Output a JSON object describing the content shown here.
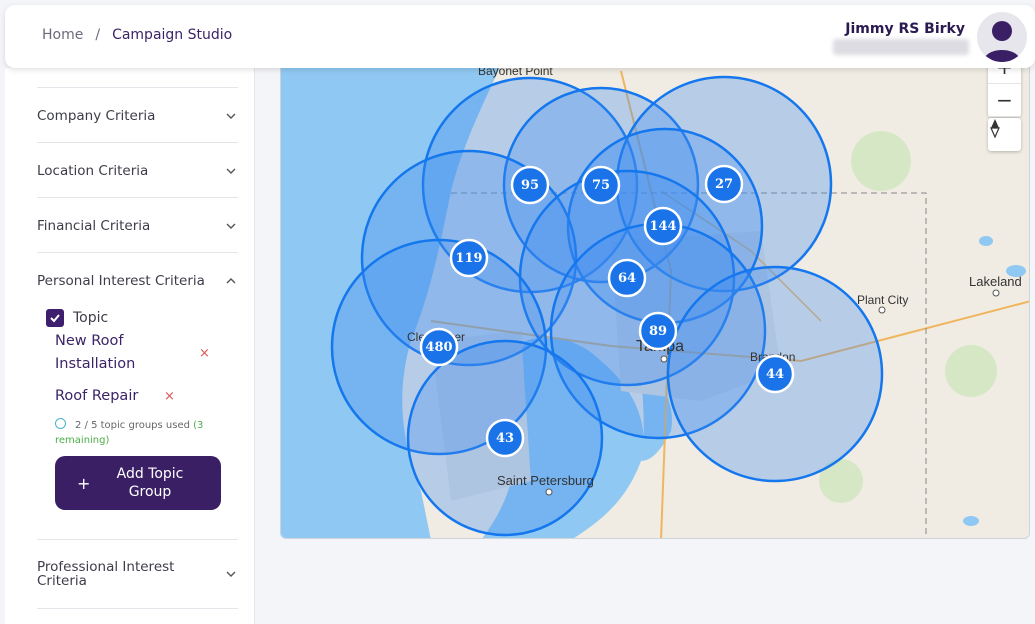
{
  "breadcrumb": {
    "home": "Home",
    "separator": "/",
    "current": "Campaign Studio"
  },
  "user": {
    "name": "Jimmy  RS Birky"
  },
  "sidebar": {
    "sections": [
      {
        "title": "Company Criteria",
        "expanded": false
      },
      {
        "title": "Location Criteria",
        "expanded": false
      },
      {
        "title": "Financial Criteria",
        "expanded": false
      },
      {
        "title": "Personal Interest Criteria",
        "expanded": true
      },
      {
        "title": "Professional Interest Criteria",
        "expanded": false
      }
    ],
    "topic": {
      "label": "Topic",
      "checked": true
    },
    "chips": [
      {
        "label": "New Roof Installation",
        "remove": "×"
      },
      {
        "label": "Roof Repair",
        "remove": "×"
      }
    ],
    "usage": {
      "text": "2 / 5 topic groups used",
      "remaining": "(3 remaining)"
    },
    "add_button": {
      "icon": "+",
      "label": "Add Topic Group"
    }
  },
  "map": {
    "controls": {
      "zoom_in": "+",
      "zoom_out": "−",
      "compass": "compass-icon"
    },
    "places": [
      "Bayonet Point",
      "Clearwater",
      "Tampa",
      "Brandon",
      "Plant City",
      "Lakeland",
      "Saint Petersburg"
    ],
    "clusters": [
      {
        "count": "95"
      },
      {
        "count": "75"
      },
      {
        "count": "27"
      },
      {
        "count": "144"
      },
      {
        "count": "119"
      },
      {
        "count": "64"
      },
      {
        "count": "89"
      },
      {
        "count": "480"
      },
      {
        "count": "44"
      },
      {
        "count": "43"
      }
    ],
    "colors": {
      "radius_fill": "#3d8df0",
      "radius_stroke": "#1477ee",
      "marker": "#1a73e8",
      "water": "#8fc8f2",
      "land": "#f0ece3"
    }
  }
}
